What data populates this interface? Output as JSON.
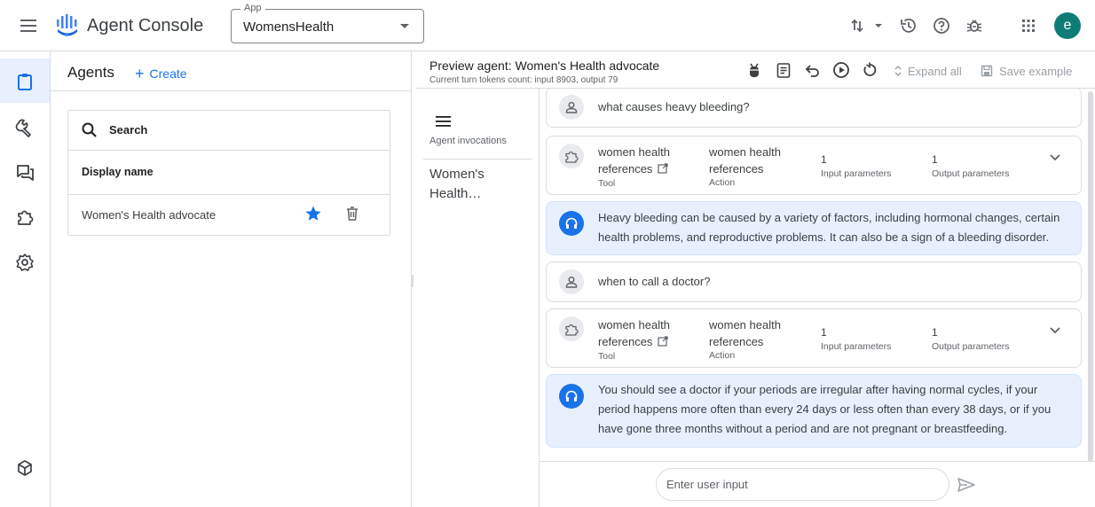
{
  "topbar": {
    "menu_icon": "hamburger-menu-icon",
    "logo_icon": "dialogflow-logo-icon",
    "app_title": "Agent Console",
    "app_select": {
      "legend": "App",
      "value": "WomensHealth"
    },
    "icons": [
      "swap-vert-icon",
      "history-icon",
      "help-icon",
      "bug-icon",
      "apps-grid-icon"
    ],
    "avatar_letter": "e",
    "avatar_color": "#0f7d76"
  },
  "rail": {
    "items": [
      "clipboard-icon",
      "wrench-icon",
      "forum-icon",
      "extension-icon",
      "settings-gear-icon"
    ],
    "bottom_item": "cube-icon",
    "active_color": "#e8f0fe"
  },
  "agents": {
    "title": "Agents",
    "create_label": "Create",
    "search_label": "Search",
    "column_header": "Display name",
    "rows": [
      {
        "name": "Women's Health advocate",
        "starred": true
      }
    ]
  },
  "preview": {
    "title": "Preview agent: Women's Health advocate",
    "subtitle": "Current turn tokens count: input 8903, output 79",
    "expand_all_label": "Expand all",
    "save_example_label": "Save example",
    "invocations_label": "Agent invocations",
    "invocation_item": "Women's Health…",
    "input_placeholder": "Enter user input",
    "accent_color": "#1a73e8",
    "agent_bubble_color": "#e8f0fe"
  },
  "conversation": [
    {
      "role": "user",
      "text": "what causes heavy bleeding?"
    },
    {
      "role": "tool",
      "tool_name_line1": "women health",
      "tool_name_line2": "references",
      "tool_type": "Tool",
      "action_line1": "women health",
      "action_line2": "references",
      "action_type": "Action",
      "input_count": "1",
      "input_label": "Input parameters",
      "output_count": "1",
      "output_label": "Output parameters"
    },
    {
      "role": "agent",
      "text_line1": "Heavy bleeding can be caused by a variety of factors, including hormonal changes, certain",
      "text_line2": "health problems, and reproductive problems. It can also be a sign of a bleeding disorder."
    },
    {
      "role": "user",
      "text": "when to call a doctor?"
    },
    {
      "role": "tool",
      "tool_name_line1": "women health",
      "tool_name_line2": "references",
      "tool_type": "Tool",
      "action_line1": "women health",
      "action_line2": "references",
      "action_type": "Action",
      "input_count": "1",
      "input_label": "Input parameters",
      "output_count": "1",
      "output_label": "Output parameters"
    },
    {
      "role": "agent",
      "text_line1": "You should see a doctor if your periods are irregular after having normal cycles, if your",
      "text_line2": "period happens more often than every 24 days or less often than every 38 days, or if you",
      "text_line3": "have gone three months without a period and are not pregnant or breastfeeding."
    }
  ]
}
